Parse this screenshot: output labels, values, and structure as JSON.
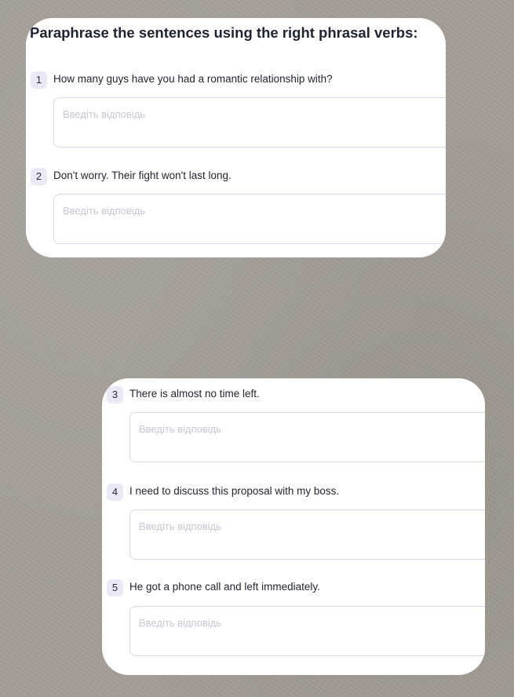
{
  "heading": "Paraphrase the sentences using the right phrasal verbs:",
  "answer_placeholder": "Введіть відповідь",
  "questions": [
    {
      "number": "1",
      "text": "How many guys have you had a romantic relationship with?",
      "answer": ""
    },
    {
      "number": "2",
      "text": "Don't worry. Their fight won't last long.",
      "answer": ""
    },
    {
      "number": "3",
      "text": "There is almost no time left.",
      "answer": ""
    },
    {
      "number": "4",
      "text": "I need to discuss this proposal with my boss.",
      "answer": ""
    },
    {
      "number": "5",
      "text": "He got a phone call and left immediately.",
      "answer": ""
    }
  ],
  "colors": {
    "background": "#a39d96",
    "card": "#ffffff",
    "number_badge": "#ebe9f5",
    "input_border": "#d8d8e6",
    "placeholder": "#c7c7d6",
    "text": "#222630"
  }
}
